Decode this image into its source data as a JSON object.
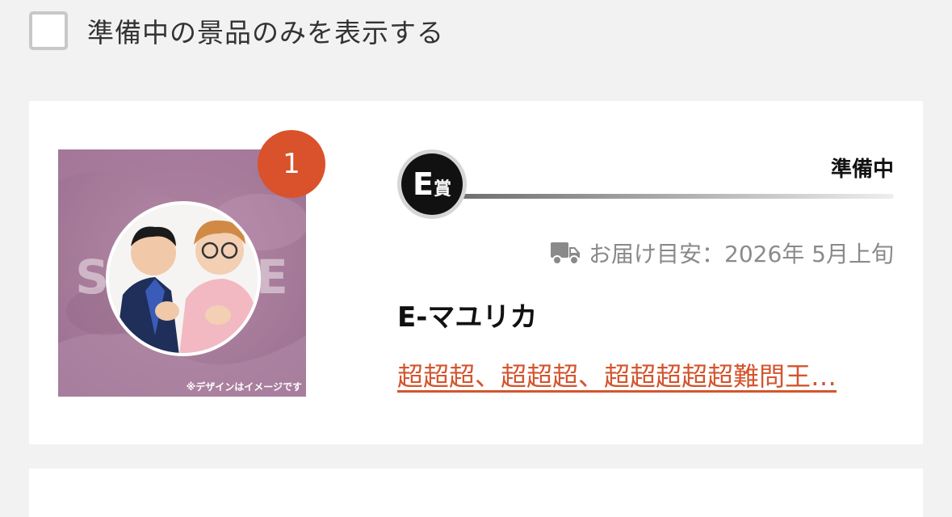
{
  "filter": {
    "checked": false,
    "label": "準備中の景品のみを表示する"
  },
  "prize": {
    "count": "1",
    "grade_letter": "E",
    "grade_suffix": "賞",
    "status": "準備中",
    "delivery_icon": "truck-icon",
    "delivery_label": "お届け目安：2026年 5月上旬",
    "name": "E-マユリカ",
    "link_text": "超超超、超超超、超超超超超難問王…",
    "image": {
      "watermark": "SAMPLE",
      "caption": "※デザインはイメージです"
    }
  },
  "colors": {
    "page_bg": "#f2f2f2",
    "card_bg": "#ffffff",
    "accent": "#d9522b",
    "link": "#d4552e",
    "muted_text": "#8a8a8a"
  }
}
